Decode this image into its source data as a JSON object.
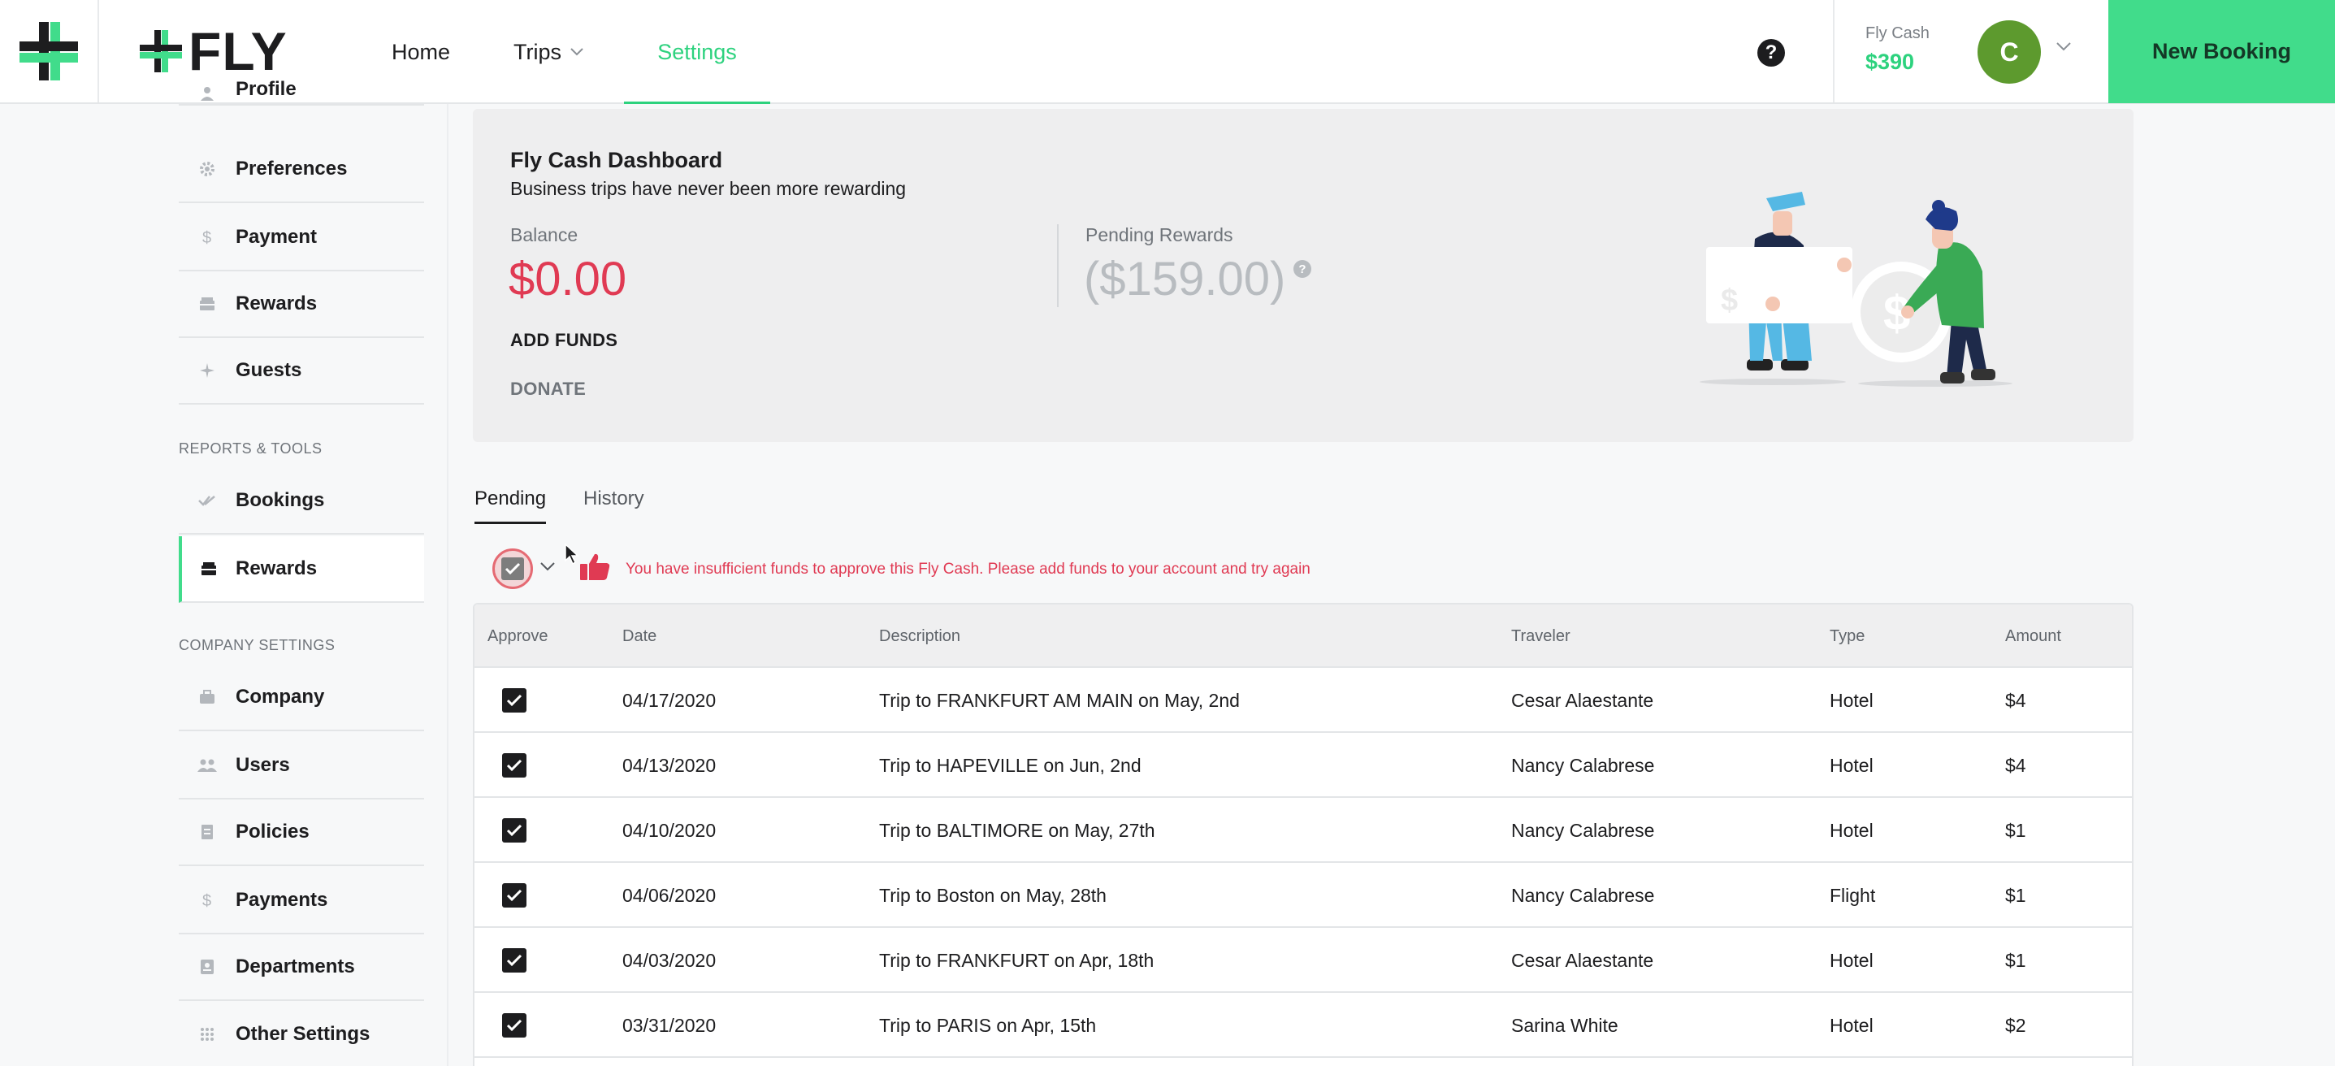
{
  "header": {
    "brand": "FLY",
    "nav": {
      "home": "Home",
      "trips": "Trips",
      "settings": "Settings"
    },
    "help_label": "?",
    "fly_cash": {
      "label": "Fly Cash",
      "value": "$390"
    },
    "avatar_initial": "C",
    "new_booking": "New Booking"
  },
  "sidebar": {
    "items_top": [
      {
        "label": "Profile",
        "icon": "person-icon"
      },
      {
        "label": "Preferences",
        "icon": "gear-icon"
      },
      {
        "label": "Payment",
        "icon": "dollar-icon"
      },
      {
        "label": "Rewards",
        "icon": "gift-icon"
      },
      {
        "label": "Guests",
        "icon": "plane-icon"
      }
    ],
    "section_reports": "REPORTS & TOOLS",
    "items_reports": [
      {
        "label": "Bookings",
        "icon": "check-icon"
      },
      {
        "label": "Rewards",
        "icon": "gift-icon",
        "active": true
      }
    ],
    "section_company": "COMPANY SETTINGS",
    "items_company": [
      {
        "label": "Company",
        "icon": "briefcase-icon"
      },
      {
        "label": "Users",
        "icon": "users-icon"
      },
      {
        "label": "Policies",
        "icon": "document-icon"
      },
      {
        "label": "Payments",
        "icon": "dollar-icon"
      },
      {
        "label": "Departments",
        "icon": "badge-icon"
      },
      {
        "label": "Other Settings",
        "icon": "grid-icon"
      }
    ]
  },
  "dashboard": {
    "title": "Fly Cash Dashboard",
    "subtitle": "Business trips have never been more rewarding",
    "balance_label": "Balance",
    "balance_value": "$0.00",
    "add_funds": "ADD FUNDS",
    "donate": "DONATE",
    "pending_label": "Pending Rewards",
    "pending_value": "($159.00)",
    "pending_help": "?"
  },
  "tabs": {
    "pending": "Pending",
    "history": "History"
  },
  "warning": "You have insufficient funds to approve this Fly Cash. Please add funds to your account and try again",
  "table": {
    "headers": {
      "approve": "Approve",
      "date": "Date",
      "description": "Description",
      "traveler": "Traveler",
      "type": "Type",
      "amount": "Amount"
    },
    "rows": [
      {
        "date": "04/17/2020",
        "description": "Trip to FRANKFURT AM MAIN on May, 2nd",
        "traveler": "Cesar Alaestante",
        "type": "Hotel",
        "amount": "$4",
        "approved": true
      },
      {
        "date": "04/13/2020",
        "description": "Trip to HAPEVILLE on Jun, 2nd",
        "traveler": "Nancy Calabrese",
        "type": "Hotel",
        "amount": "$4",
        "approved": true
      },
      {
        "date": "04/10/2020",
        "description": "Trip to BALTIMORE on May, 27th",
        "traveler": "Nancy Calabrese",
        "type": "Hotel",
        "amount": "$1",
        "approved": true
      },
      {
        "date": "04/06/2020",
        "description": "Trip to Boston on May, 28th",
        "traveler": "Nancy Calabrese",
        "type": "Flight",
        "amount": "$1",
        "approved": true
      },
      {
        "date": "04/03/2020",
        "description": "Trip to FRANKFURT on Apr, 18th",
        "traveler": "Cesar Alaestante",
        "type": "Hotel",
        "amount": "$1",
        "approved": true
      },
      {
        "date": "03/31/2020",
        "description": "Trip to PARIS on Apr, 15th",
        "traveler": "Sarina White",
        "type": "Hotel",
        "amount": "$2",
        "approved": true
      }
    ]
  },
  "colors": {
    "accent": "#41dc8b",
    "accent_text": "#2dd27e",
    "negative": "#e03a53"
  }
}
